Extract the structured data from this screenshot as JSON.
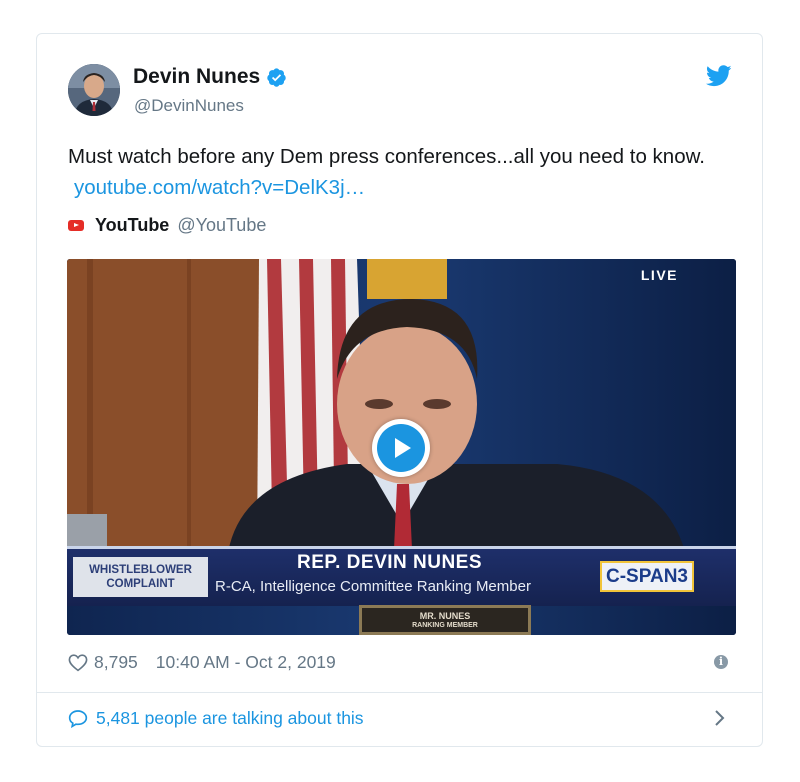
{
  "tweet": {
    "author_name": "Devin Nunes",
    "handle": "@DevinNunes",
    "verified": true,
    "text": "Must watch before any Dem press conferences...all you need to know.",
    "link_text": "youtube.com/watch?v=DelK3j…"
  },
  "card": {
    "source_name": "YouTube",
    "source_handle": "@YouTube",
    "live_label": "LIVE",
    "chyron_tag_line1": "WHISTLEBLOWER",
    "chyron_tag_line2": "COMPLAINT",
    "chyron_name": "REP. DEVIN NUNES",
    "chyron_subtitle": "R-CA, Intelligence Committee Ranking Member",
    "network": "C-SPAN3",
    "nameplate_line1": "MR. NUNES",
    "nameplate_line2": "RANKING MEMBER"
  },
  "footer": {
    "likes": "8,795",
    "timestamp": "10:40 AM - Oct 2, 2019",
    "talking": "5,481 people are talking about this"
  },
  "colors": {
    "accent": "#1b95e0",
    "secondary_text": "#657786",
    "border": "#e1e8ed",
    "youtube_red": "#e52d27"
  },
  "icons": [
    "verified-badge-icon",
    "twitter-bird-icon",
    "youtube-icon",
    "play-icon",
    "heart-icon",
    "info-icon",
    "reply-bubble-icon",
    "chevron-right-icon"
  ]
}
